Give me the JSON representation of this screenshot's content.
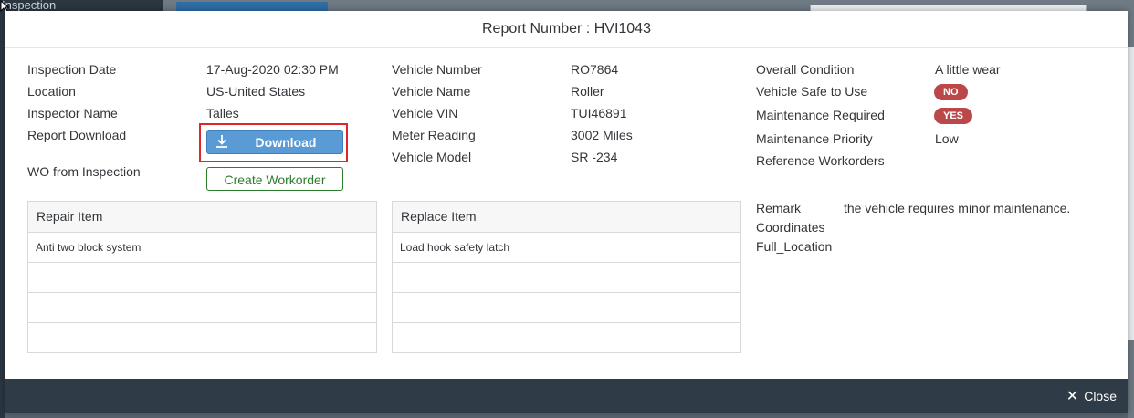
{
  "background": {
    "sidebar_title": "Inspection"
  },
  "dialog": {
    "title": "Report Number : HVI1043",
    "column1": {
      "inspection_date_label": "Inspection Date",
      "inspection_date": "17-Aug-2020 02:30 PM",
      "location_label": "Location",
      "location": "US-United States",
      "inspector_name_label": "Inspector Name",
      "inspector_name": "Talles",
      "report_download_label": "Report Download",
      "download_button": "Download",
      "wo_label": "WO from Inspection",
      "create_workorder_button": "Create Workorder"
    },
    "column2": {
      "vehicle_number_label": "Vehicle Number",
      "vehicle_number": "RO7864",
      "vehicle_name_label": "Vehicle Name",
      "vehicle_name": "Roller",
      "vehicle_vin_label": "Vehicle VIN",
      "vehicle_vin": "TUI46891",
      "meter_reading_label": "Meter Reading",
      "meter_reading": "3002 Miles",
      "vehicle_model_label": "Vehicle Model",
      "vehicle_model": "SR -234"
    },
    "column3": {
      "overall_condition_label": "Overall Condition",
      "overall_condition": "A little wear",
      "safe_label": "Vehicle Safe to Use",
      "safe_value": "NO",
      "maintenance_required_label": "Maintenance Required",
      "maintenance_required": "YES",
      "maintenance_priority_label": "Maintenance Priority",
      "maintenance_priority": "Low",
      "reference_workorders_label": "Reference Workorders",
      "remark_label": "Remark",
      "remark": "the vehicle requires minor maintenance.",
      "coordinates_label": "Coordinates",
      "full_location_label": "Full_Location"
    },
    "repair_table": {
      "header": "Repair Item",
      "rows": [
        "Anti two block system",
        "",
        "",
        ""
      ]
    },
    "replace_table": {
      "header": "Replace Item",
      "rows": [
        "Load hook safety latch",
        "",
        "",
        ""
      ]
    },
    "close_button": "Close",
    "badge_color": "#bb4848",
    "accent_color": "#5a9ad5",
    "success_color": "#2b7c2b"
  }
}
